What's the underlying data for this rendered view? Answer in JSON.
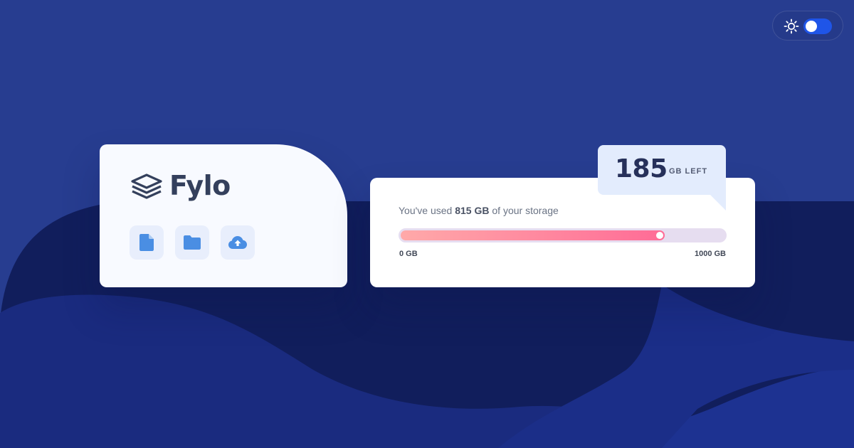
{
  "brand": {
    "name": "Fylo",
    "logo_icon": "stacked-layers-icon"
  },
  "theme_toggle": {
    "icon": "sun-icon",
    "state": "light"
  },
  "actions": [
    {
      "icon": "document-icon"
    },
    {
      "icon": "folder-icon"
    },
    {
      "icon": "cloud-upload-icon"
    }
  ],
  "storage": {
    "usage_prefix": "You've used ",
    "used_value": "815 GB",
    "usage_suffix": " of your storage",
    "scale_min": "0 GB",
    "scale_max": "1000 GB",
    "used_fraction": 0.815,
    "remaining_value": "185",
    "remaining_unit": "GB LEFT"
  },
  "colors": {
    "background": "#263b8f",
    "wave_dark": "#111e5c",
    "wave_light": "#1d3291",
    "card": "#ffffff",
    "progress_start": "#ffa9a9",
    "progress_end": "#ff6b96",
    "toggle_accent": "#1f55e8"
  }
}
